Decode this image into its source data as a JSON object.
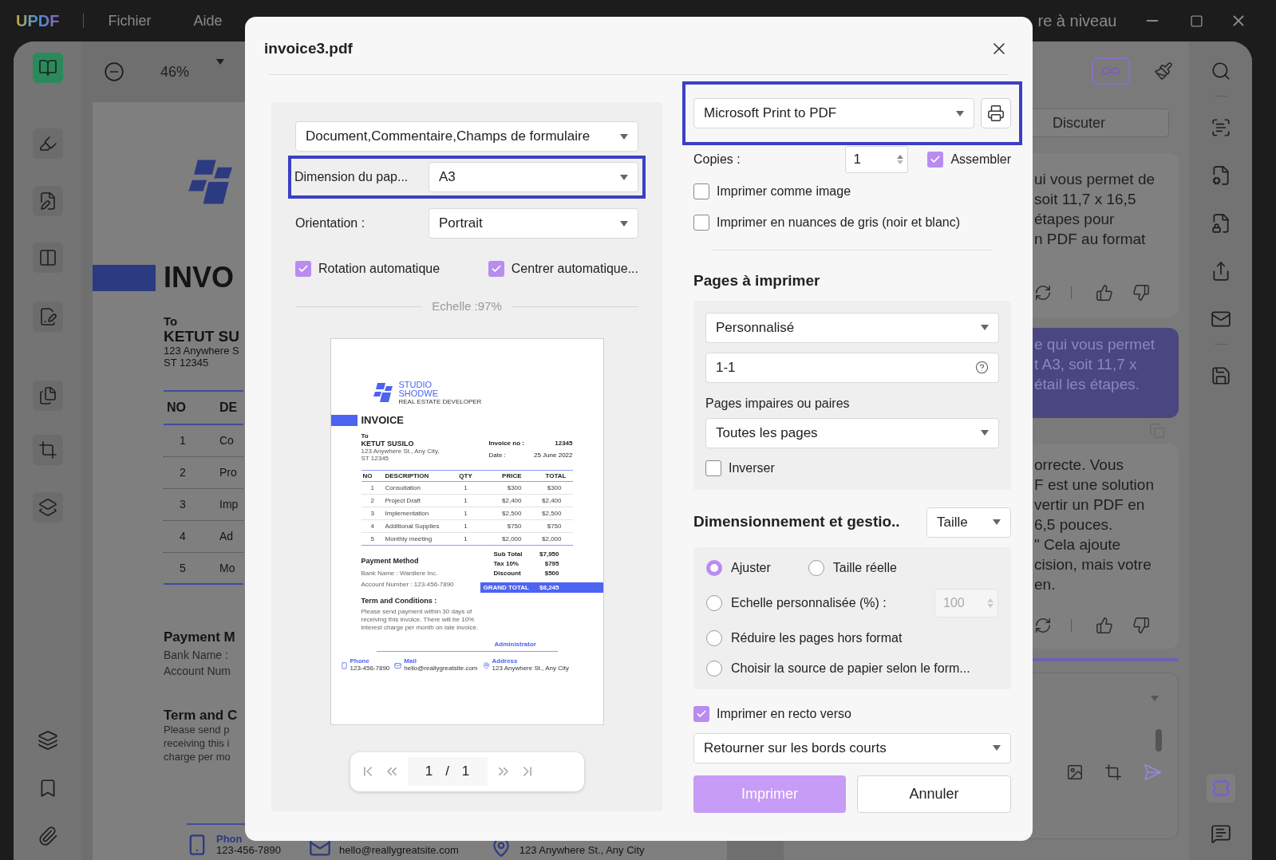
{
  "titlebar": {
    "logo": "UPDF",
    "menus": [
      "Fichier",
      "Aide"
    ],
    "upgrade": "re à niveau"
  },
  "toolbar": {
    "zoom": "46%"
  },
  "left_tools": [
    {
      "selected": true
    },
    {
      "selected": false
    },
    {
      "selected": false
    },
    {
      "selected": false
    },
    {
      "selected": false
    },
    {
      "selected": false
    },
    {
      "selected": false
    },
    {
      "selected": false
    }
  ],
  "document": {
    "title": "INVO",
    "to_label": "To",
    "name": "KETUT SU",
    "address": [
      "123 Anywhere S",
      "ST 12345"
    ],
    "table_header": [
      "NO",
      "DE"
    ],
    "rows": [
      [
        "1",
        "Co"
      ],
      [
        "2",
        "Pro"
      ],
      [
        "3",
        "Imp"
      ],
      [
        "4",
        "Ad"
      ],
      [
        "5",
        "Mo"
      ]
    ],
    "payment_title": "Payment M",
    "payment_lines": [
      "Bank Name :",
      "Account Num"
    ],
    "terms_title": "Term and C",
    "terms_lines": [
      "Please send p",
      "receiving this i",
      "charge per mo"
    ],
    "footer": {
      "phone_label": "Phon",
      "phone": "123-456-7890",
      "mail": "hello@reallygreatsite.com",
      "address": "123 Anywhere St., Any City"
    }
  },
  "chat": {
    "tab": "Discuter",
    "messages": [
      {
        "kind": "answer",
        "lines": [
          "ui vous permet de",
          "soit 11,7 x 16,5",
          "étapes pour",
          "n PDF au format"
        ]
      },
      {
        "kind": "question",
        "lines": [
          "e qui vous permet",
          "t A3, soit 11,7 x",
          "étail les étapes."
        ]
      },
      {
        "kind": "answer",
        "lines": [
          "orrecte. Vous",
          "F est une solution",
          "vertir un PDF en",
          "6,5 pouces.",
          "\" Cela ajoute",
          "cision, mais votre",
          "en."
        ]
      }
    ]
  },
  "dialog": {
    "title": "invoice3.pdf",
    "content_select": "Document,Commentaire,Champs de formulaire",
    "paper_label": "Dimension du pap...",
    "paper_value": "A3",
    "orientation_label": "Orientation :",
    "orientation_value": "Portrait",
    "layout_options": [
      {
        "label": "Rotation automatique",
        "checked": true
      },
      {
        "label": "Centrer automatique...",
        "checked": true
      }
    ],
    "scale_label": "Echelle :97%",
    "preview": {
      "brand": [
        "STUDIO",
        "SHODWE"
      ],
      "tagline": "REAL ESTATE DEVELOPER",
      "heading": "INVOICE",
      "to_label": "To",
      "name": "KETUT SUSILO",
      "address": [
        "123 Anywhere St., Any City,",
        "ST 12345"
      ],
      "meta": [
        [
          "Invoice no :",
          "12345"
        ],
        [
          "Date :",
          "25 June 2022"
        ]
      ],
      "columns": [
        "NO",
        "DESCRIPTION",
        "QTY",
        "PRICE",
        "TOTAL"
      ],
      "rows": [
        [
          "1",
          "Consultation",
          "1",
          "$300",
          "$300"
        ],
        [
          "2",
          "Project Draft",
          "1",
          "$2,400",
          "$2,400"
        ],
        [
          "3",
          "Implementation",
          "1",
          "$2,500",
          "$2,500"
        ],
        [
          "4",
          "Additional Supplies",
          "1",
          "$750",
          "$750"
        ],
        [
          "5",
          "Monthly meeting",
          "1",
          "$2,000",
          "$2,000"
        ]
      ],
      "totals": [
        [
          "Sub Total",
          "$7,950"
        ],
        [
          "Tax 10%",
          "$795"
        ],
        [
          "Discount",
          "$500"
        ]
      ],
      "grand_total": [
        "GRAND TOTAL",
        "$8,245"
      ],
      "payment_title": "Payment Method",
      "payment_lines": [
        "Bank Name : Wardiere Inc.",
        "Account Number : 123-456-7890"
      ],
      "terms_title": "Term and Conditions :",
      "terms_text": "Please send payment within 30 days of receiving this invoice. There will be 10% interest charge per month on late invoice.",
      "signature": "Administrator",
      "contacts": [
        {
          "label": "Phone",
          "value": "123-456-7890"
        },
        {
          "label": "Mail",
          "value": "hello@reallygreatsite.com"
        },
        {
          "label": "Address",
          "value": "123 Anywhere St., Any City"
        }
      ]
    },
    "pager": {
      "current": "1",
      "separator": "/",
      "total": "1"
    },
    "printer": "Microsoft Print to PDF",
    "copies_label": "Copies :",
    "copies_value": "1",
    "collate": {
      "label": "Assembler",
      "checked": true
    },
    "print_options": [
      {
        "label": "Imprimer comme image",
        "checked": false
      },
      {
        "label": "Imprimer en nuances de gris (noir et blanc)",
        "checked": false
      }
    ],
    "pages_title": "Pages à imprimer",
    "pages_select": "Personnalisé",
    "pages_range": "1-1",
    "parity_label": "Pages impaires ou paires",
    "parity_select": "Toutes les pages",
    "reverse": {
      "label": "Inverser",
      "checked": false
    },
    "sizing_title": "Dimensionnement et gestio..",
    "sizing_select": "Taille",
    "sizing_options": [
      {
        "label": "Ajuster",
        "selected": true
      },
      {
        "label": "Taille réelle",
        "selected": false
      },
      {
        "label": "Echelle personnalisée (%) :",
        "selected": false
      },
      {
        "label": "Réduire les pages hors format",
        "selected": false
      },
      {
        "label": "Choisir la source de papier selon le form...",
        "selected": false
      }
    ],
    "custom_scale": {
      "value": "100",
      "disabled": true
    },
    "duplex": {
      "label": "Imprimer en recto verso",
      "checked": true
    },
    "duplex_select": "Retourner sur les bords courts",
    "buttons": [
      {
        "label": "Imprimer",
        "kind": "primary"
      },
      {
        "label": "Annuler",
        "kind": "secondary"
      }
    ]
  }
}
